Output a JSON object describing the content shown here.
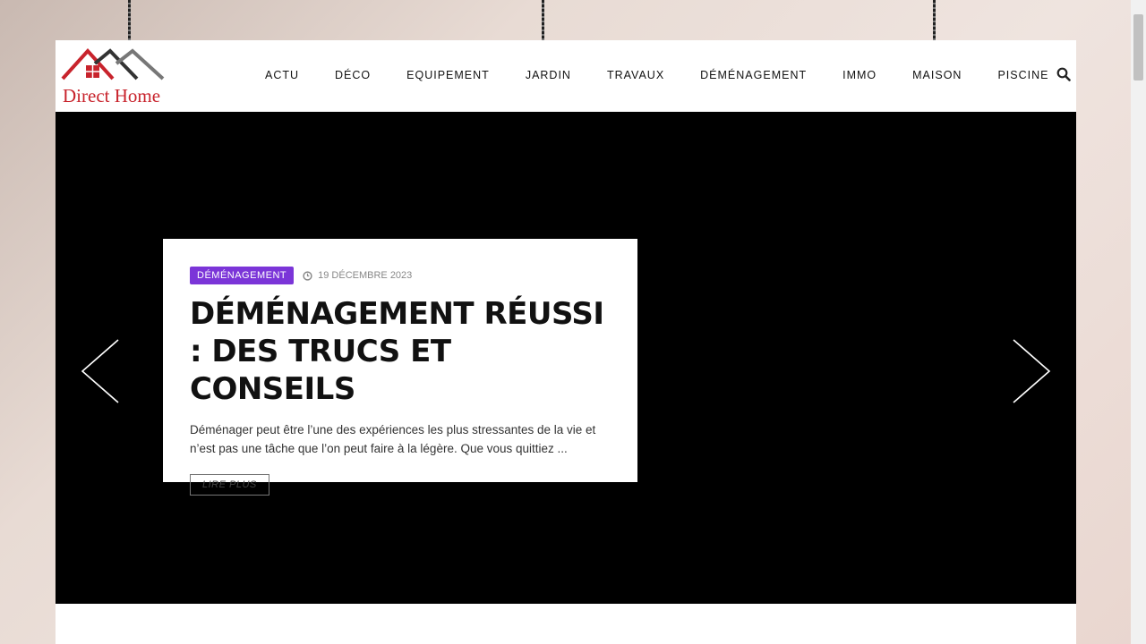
{
  "brand": {
    "name": "Direct Home",
    "colors": {
      "red": "#c8232c",
      "accent": "#7b35d8"
    }
  },
  "nav": {
    "items": [
      "ACTU",
      "DÉCO",
      "EQUIPEMENT",
      "JARDIN",
      "TRAVAUX",
      "DÉMÉNAGEMENT",
      "IMMO",
      "MAISON",
      "PISCINE"
    ],
    "search_icon": "search-icon"
  },
  "slide": {
    "category": "DÉMÉNAGEMENT",
    "date": "19 DÉCEMBRE 2023",
    "title": "DÉMÉNAGEMENT RÉUSSI : DES TRUCS ET CONSEILS",
    "excerpt": "Déménager peut être l’une des expériences les plus stressantes de la vie et n’est pas une tâche que l’on peut faire à la légère. Que vous quittiez ...",
    "read_more": "LIRE PLUS"
  }
}
